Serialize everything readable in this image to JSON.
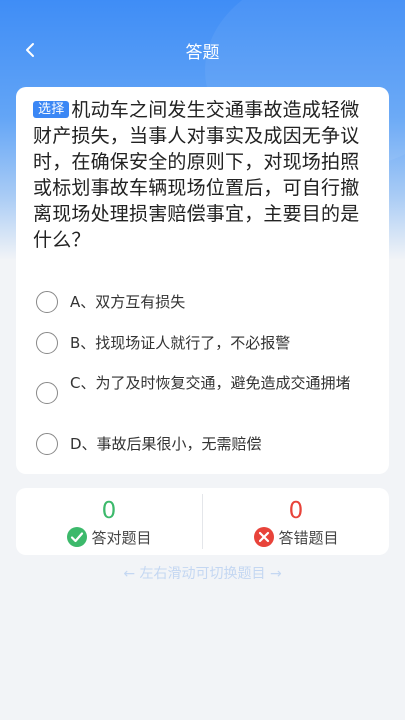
{
  "nav": {
    "title": "答题"
  },
  "question": {
    "type_tag": "选择",
    "text": "机动车之间发生交通事故造成轻微财产损失，当事人对事实及成因无争议时，在确保安全的原则下，对现场拍照或标划事故车辆现场位置后，可自行撤离现场处理损害赔偿事宜，主要目的是什么？",
    "options": [
      {
        "label": "A、双方互有损失"
      },
      {
        "label": "B、找现场证人就行了，不必报警"
      },
      {
        "label": "C、为了及时恢复交通，避免造成交通拥堵"
      },
      {
        "label": "D、事故后果很小，无需赔偿"
      }
    ]
  },
  "stats": {
    "correct_count": "0",
    "correct_label": "答对题目",
    "wrong_count": "0",
    "wrong_label": "答错题目"
  },
  "hint": {
    "swipe_text": "← 左右滑动可切换题目 →"
  },
  "colors": {
    "accent": "#3b87f5",
    "correct": "#3cb96b",
    "wrong": "#e8433a"
  },
  "icons": {
    "back": "chevron-left-icon",
    "correct": "check-circle-icon",
    "wrong": "x-circle-icon"
  }
}
